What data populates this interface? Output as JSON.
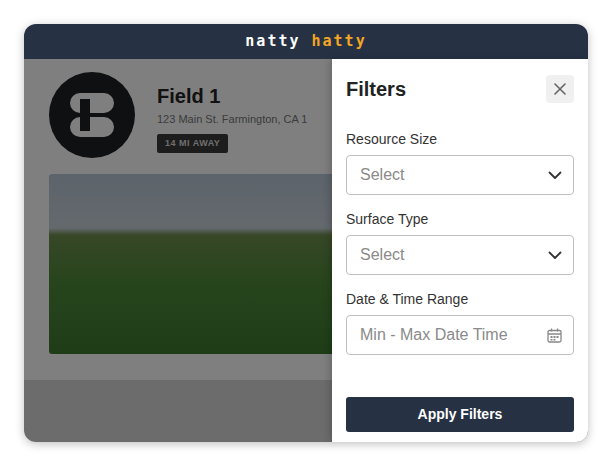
{
  "header": {
    "logo_first": "natty",
    "logo_second": "hatty"
  },
  "listing": {
    "title": "Field 1",
    "address": "123 Main St. Farmington, CA 1",
    "distance": "14 MI AWAY"
  },
  "filters": {
    "open": true,
    "title": "Filters",
    "fields": [
      {
        "label": "Resource Size",
        "kind": "select",
        "placeholder": "Select"
      },
      {
        "label": "Surface Type",
        "kind": "select",
        "placeholder": "Select"
      },
      {
        "label": "Date & Time Range",
        "kind": "date",
        "placeholder": "Min - Max Date Time"
      }
    ],
    "apply": "Apply Filters"
  }
}
